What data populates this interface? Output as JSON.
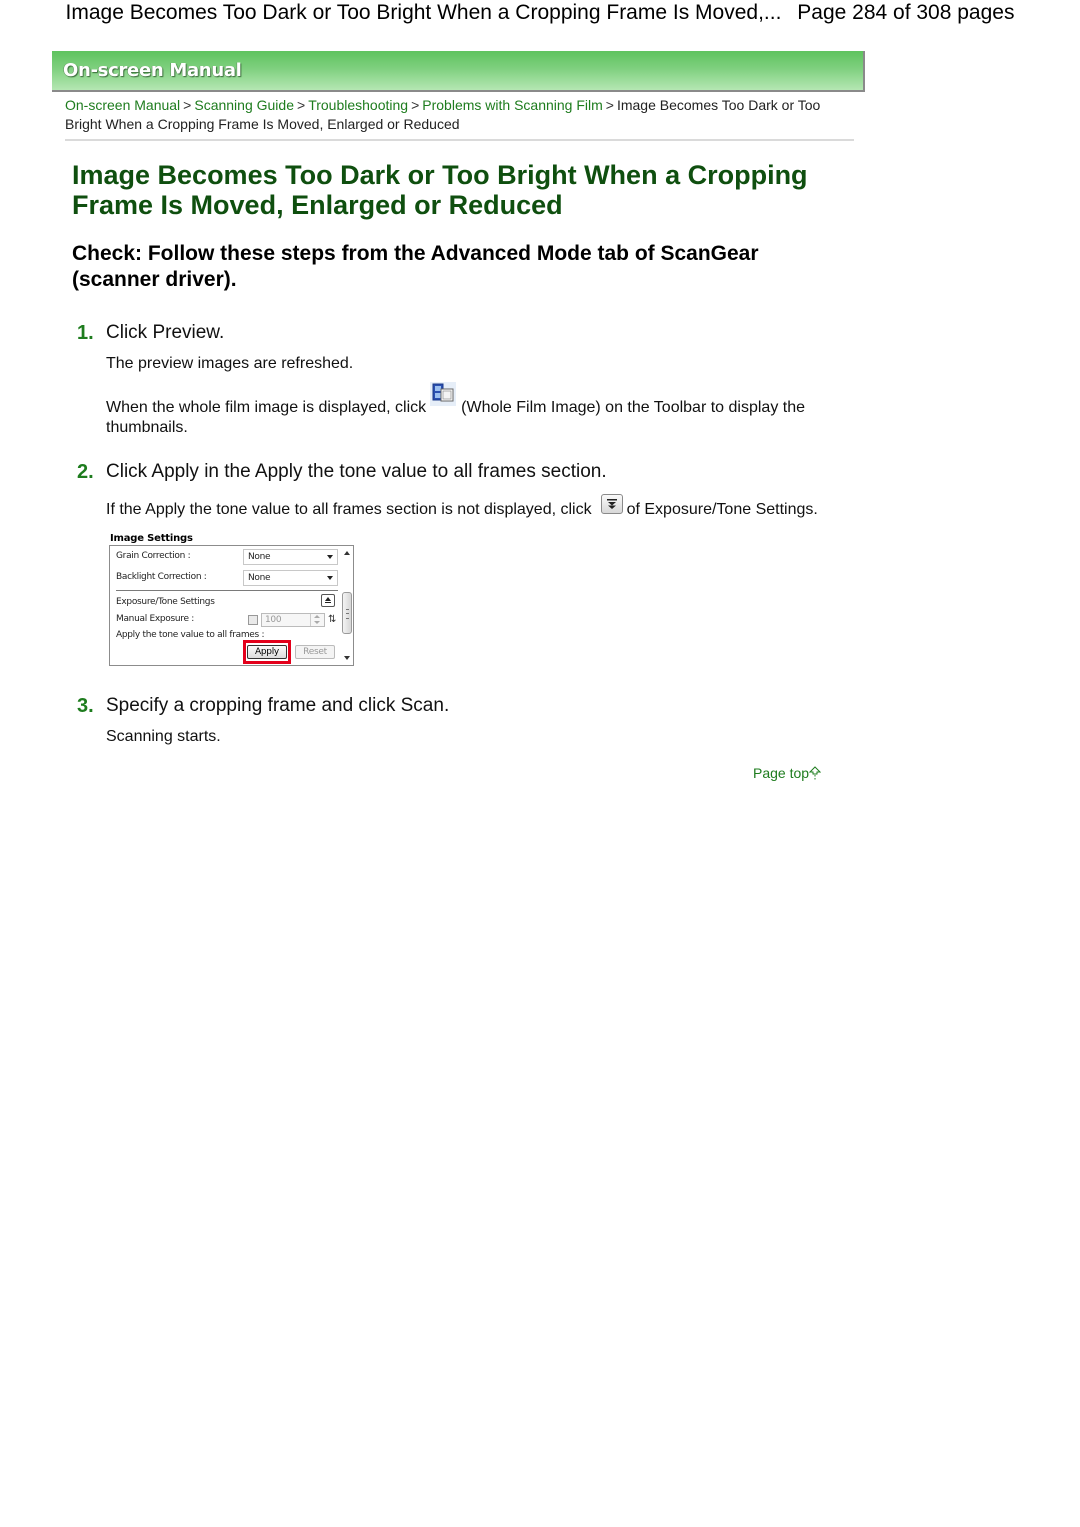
{
  "page_header": {
    "title": "Image Becomes Too Dark or Too Bright When a Cropping Frame Is Moved,...",
    "page_info": "Page 284 of 308 pages"
  },
  "banner": {
    "title": "On-screen Manual",
    "colors": {
      "gradient_top": "#5ec35e",
      "gradient_bottom": "#b5e7b3"
    }
  },
  "breadcrumb": {
    "links": [
      {
        "label": "On-screen Manual"
      },
      {
        "label": "Scanning Guide"
      },
      {
        "label": "Troubleshooting"
      },
      {
        "label": "Problems with Scanning Film"
      }
    ],
    "separator": ">",
    "current": "Image Becomes Too Dark or Too Bright When a Cropping Frame Is Moved, Enlarged or Reduced"
  },
  "article": {
    "title": "Image Becomes Too Dark or Too Bright When a Cropping Frame Is Moved, Enlarged or Reduced",
    "check_heading": "Check: Follow these steps from the Advanced Mode tab of ScanGear (scanner driver).",
    "accent_color": "#1e7c1e",
    "title_color": "#0f4f0f",
    "steps": [
      {
        "number": "1.",
        "text": "Click Preview.",
        "paragraphs": [
          {
            "text": "The preview images are refreshed."
          },
          {
            "before_icon": "When the whole film image is displayed, click",
            "icon": "whole-film-image-icon",
            "after_icon": "(Whole Film Image) on the Toolbar to display the",
            "continuation": "thumbnails."
          }
        ]
      },
      {
        "number": "2.",
        "text": "Click Apply in the Apply the tone value to all frames section.",
        "paragraphs": [
          {
            "before_icon": "If the Apply the tone value to all frames section is not displayed, click",
            "icon": "expand-icon",
            "after_icon": "of Exposure/Tone Settings."
          }
        ]
      },
      {
        "number": "3.",
        "text": "Specify a cropping frame and click Scan.",
        "paragraphs": [
          {
            "text": "Scanning starts."
          }
        ]
      }
    ]
  },
  "screenshot_panel": {
    "heading": "Image Settings",
    "grain_correction_label": "Grain Correction :",
    "grain_correction_value": "None",
    "backlight_correction_label": "Backlight Correction :",
    "backlight_correction_value": "None",
    "exposure_tone_label": "Exposure/Tone Settings",
    "manual_exposure_label": "Manual Exposure :",
    "manual_exposure_value": "100",
    "manual_exposure_checked": false,
    "apply_tone_label": "Apply the tone value to all frames :",
    "apply_button": "Apply",
    "reset_button": "Reset",
    "highlight_color": "#e3001b"
  },
  "footer": {
    "page_top_label": "Page top"
  }
}
